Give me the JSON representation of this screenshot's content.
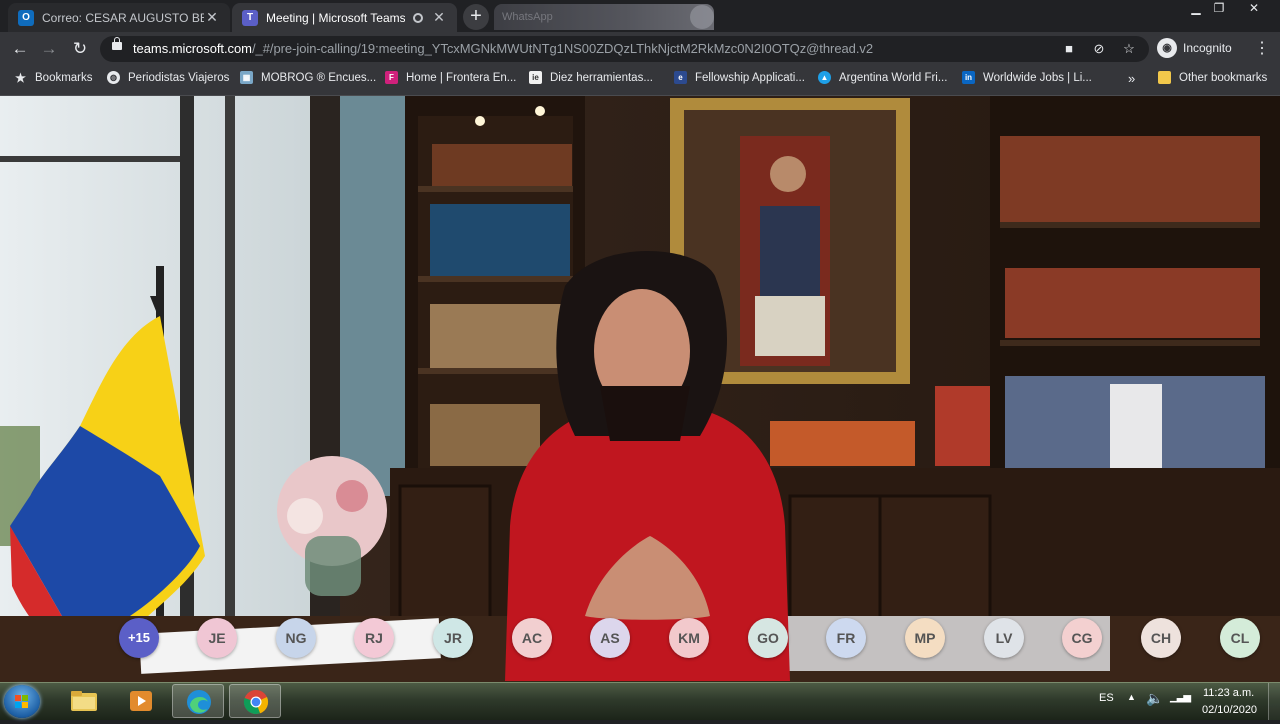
{
  "browser": {
    "tabs": [
      {
        "title": "Correo: CESAR AUGUSTO BELLO",
        "favicon": "outlook-icon",
        "state": "inactive"
      },
      {
        "title": "Meeting | Microsoft Teams",
        "favicon": "teams-icon",
        "state": "active"
      }
    ],
    "ghost_tab_label": "WhatsApp",
    "address": {
      "host": "teams.microsoft.com",
      "path": "/_#/pre-join-calling/19:meeting_YTcxMGNkMWUtNTg1NS00ZDQzLThkNjctM2RkMzc0N2I0OTQz@thread.v2"
    },
    "profile_label": "Incognito"
  },
  "bookmarks": {
    "label": "Bookmarks",
    "items": [
      {
        "label": "Periodistas Viajeros",
        "icon": "globe-icon"
      },
      {
        "label": "MOBROG ® Encues...",
        "icon": "mobrog-icon"
      },
      {
        "label": "Home | Frontera En...",
        "icon": "frontera-icon"
      },
      {
        "label": "Diez herramientas...",
        "icon": "page-icon"
      },
      {
        "label": "Fellowship Applicati...",
        "icon": "fellowship-icon"
      },
      {
        "label": "Argentina World Fri...",
        "icon": "argentina-icon"
      },
      {
        "label": "Worldwide Jobs | Li...",
        "icon": "linkedin-icon"
      }
    ],
    "overflow": "»",
    "other": "Other bookmarks"
  },
  "meeting": {
    "participants": [
      {
        "initials": "+15",
        "color": "#5b5fc7"
      },
      {
        "initials": "JE",
        "color": "#f0c6d4"
      },
      {
        "initials": "NG",
        "color": "#c7d5ea"
      },
      {
        "initials": "RJ",
        "color": "#f3c9d6"
      },
      {
        "initials": "JR",
        "color": "#cfe7e6"
      },
      {
        "initials": "AC",
        "color": "#f2cfd0"
      },
      {
        "initials": "AS",
        "color": "#dcd6ec"
      },
      {
        "initials": "KM",
        "color": "#f2c9cc"
      },
      {
        "initials": "GO",
        "color": "#d6e6e2"
      },
      {
        "initials": "FR",
        "color": "#cdd9ef"
      },
      {
        "initials": "MP",
        "color": "#f4ddc2"
      },
      {
        "initials": "LV",
        "color": "#dfe3e8"
      },
      {
        "initials": "CG",
        "color": "#f3d0d0"
      },
      {
        "initials": "CH",
        "color": "#eee2dd"
      },
      {
        "initials": "CL",
        "color": "#d4ecd9"
      }
    ]
  },
  "taskbar": {
    "apps": [
      "file-explorer-icon",
      "media-player-icon",
      "edge-icon",
      "chrome-icon"
    ],
    "language": "ES",
    "time": "11:23 a.m.",
    "date": "02/10/2020"
  }
}
